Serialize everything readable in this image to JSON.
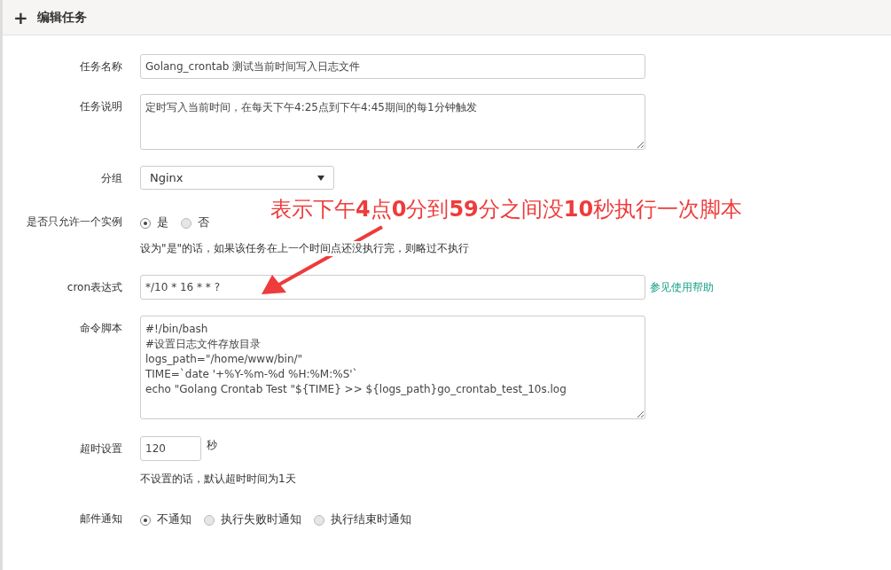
{
  "panel": {
    "icon": "+",
    "title": "编辑任务"
  },
  "form": {
    "name": {
      "label": "任务名称",
      "value": "Golang_crontab 测试当前时间写入日志文件"
    },
    "description": {
      "label": "任务说明",
      "value": "定时写入当前时间，在每天下午4:25点到下午4:45期间的每1分钟触发"
    },
    "group": {
      "label": "分组",
      "value": "Nginx"
    },
    "single_instance": {
      "label": "是否只允许一个实例",
      "options": [
        {
          "label": "是",
          "selected": true
        },
        {
          "label": "否",
          "selected": false
        }
      ],
      "hint": "设为\"是\"的话，如果该任务在上一个时间点还没执行完，则略过不执行"
    },
    "cron": {
      "label": "cron表达式",
      "value": "*/10 * 16 * * ?",
      "help_link": "参见使用帮助"
    },
    "command": {
      "label": "命令脚本",
      "lines": [
        "#!/bin/bash",
        "#设置日志文件存放目录",
        "logs_path=\"/home/www/bin/\"",
        "TIME=`date '+%Y-%m-%d %H:%M:%S'`",
        "echo \"Golang Crontab Test \"${TIME} >> ${logs_path}go_crontab_test_10s.log"
      ]
    },
    "timeout": {
      "label": "超时设置",
      "value": "120",
      "unit": "秒",
      "hint": "不设置的话，默认超时时间为1天"
    },
    "notify": {
      "label": "邮件通知",
      "options": [
        {
          "label": "不通知",
          "selected": true
        },
        {
          "label": "执行失败时通知",
          "selected": false
        },
        {
          "label": "执行结束时通知",
          "selected": false
        }
      ]
    }
  },
  "annotation": {
    "text": "表示下午**4**点**0**分到**59**分之间没**10**秒执行一次脚本"
  }
}
